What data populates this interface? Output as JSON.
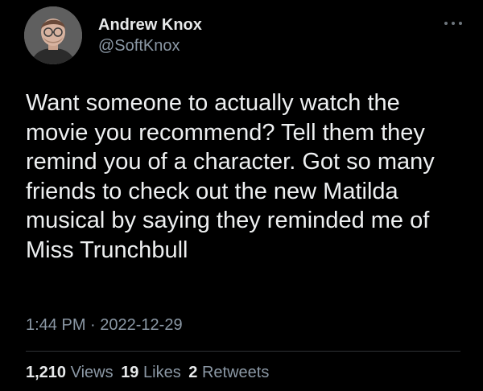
{
  "author": {
    "display_name": "Andrew Knox",
    "handle": "@SoftKnox"
  },
  "tweet": {
    "text_lines": [
      "Want someone to actually watch the",
      "movie you recommend? Tell them they",
      "remind you of a character. Got so many",
      "friends to check out the new Matilda",
      "musical by saying they reminded me of",
      "Miss Trunchbull"
    ],
    "timestamp": "1:44 PM · 2022-12-29"
  },
  "stats": {
    "views_count": "1,210",
    "views_label": "Views",
    "likes_count": "19",
    "likes_label": "Likes",
    "retweets_count": "2",
    "retweets_label": "Retweets"
  },
  "icons": {
    "more": "more-options-icon",
    "avatar": "avatar"
  },
  "colors": {
    "background": "#000000",
    "text_primary": "#e7e9ea",
    "text_secondary": "#8b98a5",
    "divider": "#2f3336"
  }
}
